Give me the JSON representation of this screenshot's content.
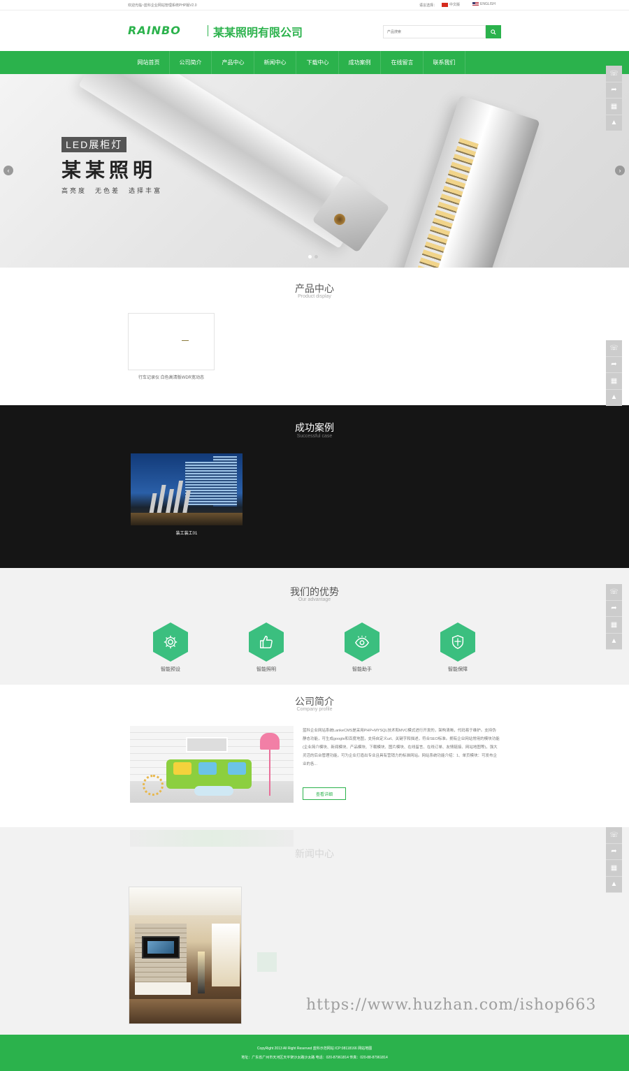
{
  "topbar": {
    "welcome": "欢迎光临~蓝科企业网站管理系统PHP版V2.0",
    "lang_label": "语言选择：",
    "lang_cn": "中文版",
    "lang_en": "ENGLISH"
  },
  "header": {
    "logo_en": "RAINBO",
    "logo_cn": "某某照明有限公司",
    "search_placeholder": "产品搜索",
    "search_icon": "search-icon"
  },
  "nav": {
    "items": [
      "网站首页",
      "公司简介",
      "产品中心",
      "新闻中心",
      "下载中心",
      "成功案例",
      "在线留言",
      "联系我们"
    ]
  },
  "banner": {
    "tag": "LED展柜灯",
    "title": "某某照明",
    "subtitle": "高亮度　无色差　选择丰富",
    "prev_icon": "chevron-left-icon",
    "next_icon": "chevron-right-icon"
  },
  "side_tools": {
    "icons": [
      "headset-icon",
      "share-icon",
      "qrcode-icon",
      "rocket-icon"
    ]
  },
  "products": {
    "title": "产品中心",
    "subtitle": "Product display",
    "items": [
      {
        "name": "行车记录仪 白色高清版WDR宽动态"
      }
    ]
  },
  "cases": {
    "title": "成功案例",
    "subtitle": "Successful case",
    "items": [
      {
        "name": "装工装工01"
      }
    ]
  },
  "advantage": {
    "title": "我们的优势",
    "subtitle": "Our advantage",
    "items": [
      {
        "label": "智能预设",
        "icon": "gear-icon"
      },
      {
        "label": "智能照明",
        "icon": "thumbs-up-icon"
      },
      {
        "label": "智能助手",
        "icon": "eye-icon"
      },
      {
        "label": "智能保障",
        "icon": "shield-icon"
      }
    ],
    "color": "#3bbf7f"
  },
  "about": {
    "title": "公司简介",
    "subtitle": "Company profile",
    "text": "蓝科企业网站系统LankeCMS是采用PHP+MYSQL技术和MVC模式进行开发的，架构清晰，代码易于维护。支持伪静态功能，可生成google和百度地图，支持自定义url、关键字和描述，符合SEO标准。拥有企业网站常用的模块功能(企业简介模块、新闻模块、产品模块、下载模块、图片模块、在线留言、在线订单、友情链接、网站地图等)，强大灵活的后台管理功能，可为企业打造出专业且具有营销力的标准网站。网站系统功能介绍：1、单页模块：可发布企业的各...",
    "button": "查看详细"
  },
  "news": {
    "title": "新闻中心"
  },
  "watermark": "https://www.huzhan.com/ishop663",
  "footer": {
    "line1": "CopyRight 2013 All Right Reserved 蓝科示范网站 ICP:08118166 网站地图",
    "line2": "地址：广东省广州市天河区天平架沙太路沙太路 电话：020-87961814 传真：020-88-87961814"
  },
  "theme": {
    "accent": "#2bb24c"
  }
}
